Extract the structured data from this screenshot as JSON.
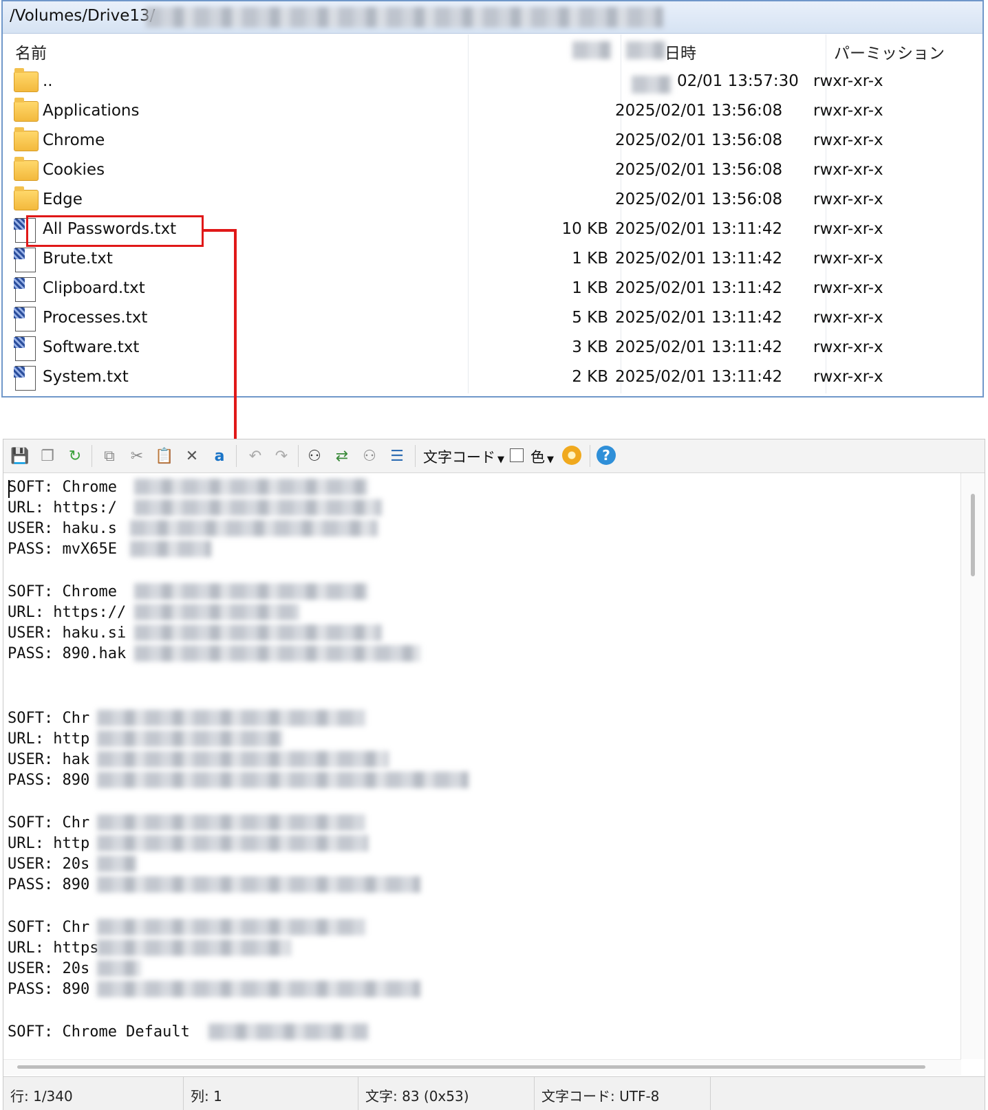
{
  "path": "/Volumes/Drive13/",
  "columns": {
    "name": "名前",
    "date_suffix": "日時",
    "permission": "パーミッション"
  },
  "files": [
    {
      "type": "parent",
      "name": "..",
      "size": "",
      "date": "02/01 13:57:30",
      "perm": "rwxr-xr-x"
    },
    {
      "type": "folder",
      "name": "Applications",
      "size": "",
      "date": "2025/02/01 13:56:08",
      "perm": "rwxr-xr-x"
    },
    {
      "type": "folder",
      "name": "Chrome",
      "size": "",
      "date": "2025/02/01 13:56:08",
      "perm": "rwxr-xr-x"
    },
    {
      "type": "folder",
      "name": "Cookies",
      "size": "",
      "date": "2025/02/01 13:56:08",
      "perm": "rwxr-xr-x"
    },
    {
      "type": "folder",
      "name": "Edge",
      "size": "",
      "date": "2025/02/01 13:56:08",
      "perm": "rwxr-xr-x"
    },
    {
      "type": "file",
      "name": "All Passwords.txt",
      "size": "10 KB",
      "date": "2025/02/01 13:11:42",
      "perm": "rwxr-xr-x"
    },
    {
      "type": "file",
      "name": "Brute.txt",
      "size": "1 KB",
      "date": "2025/02/01 13:11:42",
      "perm": "rwxr-xr-x"
    },
    {
      "type": "file",
      "name": "Clipboard.txt",
      "size": "1 KB",
      "date": "2025/02/01 13:11:42",
      "perm": "rwxr-xr-x"
    },
    {
      "type": "file",
      "name": "Processes.txt",
      "size": "5 KB",
      "date": "2025/02/01 13:11:42",
      "perm": "rwxr-xr-x"
    },
    {
      "type": "file",
      "name": "Software.txt",
      "size": "3 KB",
      "date": "2025/02/01 13:11:42",
      "perm": "rwxr-xr-x"
    },
    {
      "type": "file",
      "name": "System.txt",
      "size": "2 KB",
      "date": "2025/02/01 13:11:42",
      "perm": "rwxr-xr-x"
    }
  ],
  "toolbar": {
    "encoding_label": "文字コード",
    "color_label": "色",
    "help_label": "?"
  },
  "editor_lines": [
    "SOFT: Chrome",
    "URL: https:/",
    "USER: haku.s",
    "PASS: mvX65E",
    "",
    "SOFT: Chrome",
    "URL: https://",
    "USER: haku.si",
    "PASS: 890.hak",
    "",
    "",
    "SOFT: Chr",
    "URL: http",
    "USER: hak",
    "PASS: 890",
    "",
    "SOFT: Chr",
    "URL: http",
    "USER: 20s",
    "PASS: 890",
    "",
    "SOFT: Chr",
    "URL: https",
    "USER: 20s",
    "PASS: 890",
    "",
    "SOFT: Chrome Default"
  ],
  "status": {
    "line": "行: 1/340",
    "col": "列: 1",
    "char": "文字: 83 (0x53)",
    "encoding": "文字コード: UTF-8"
  }
}
